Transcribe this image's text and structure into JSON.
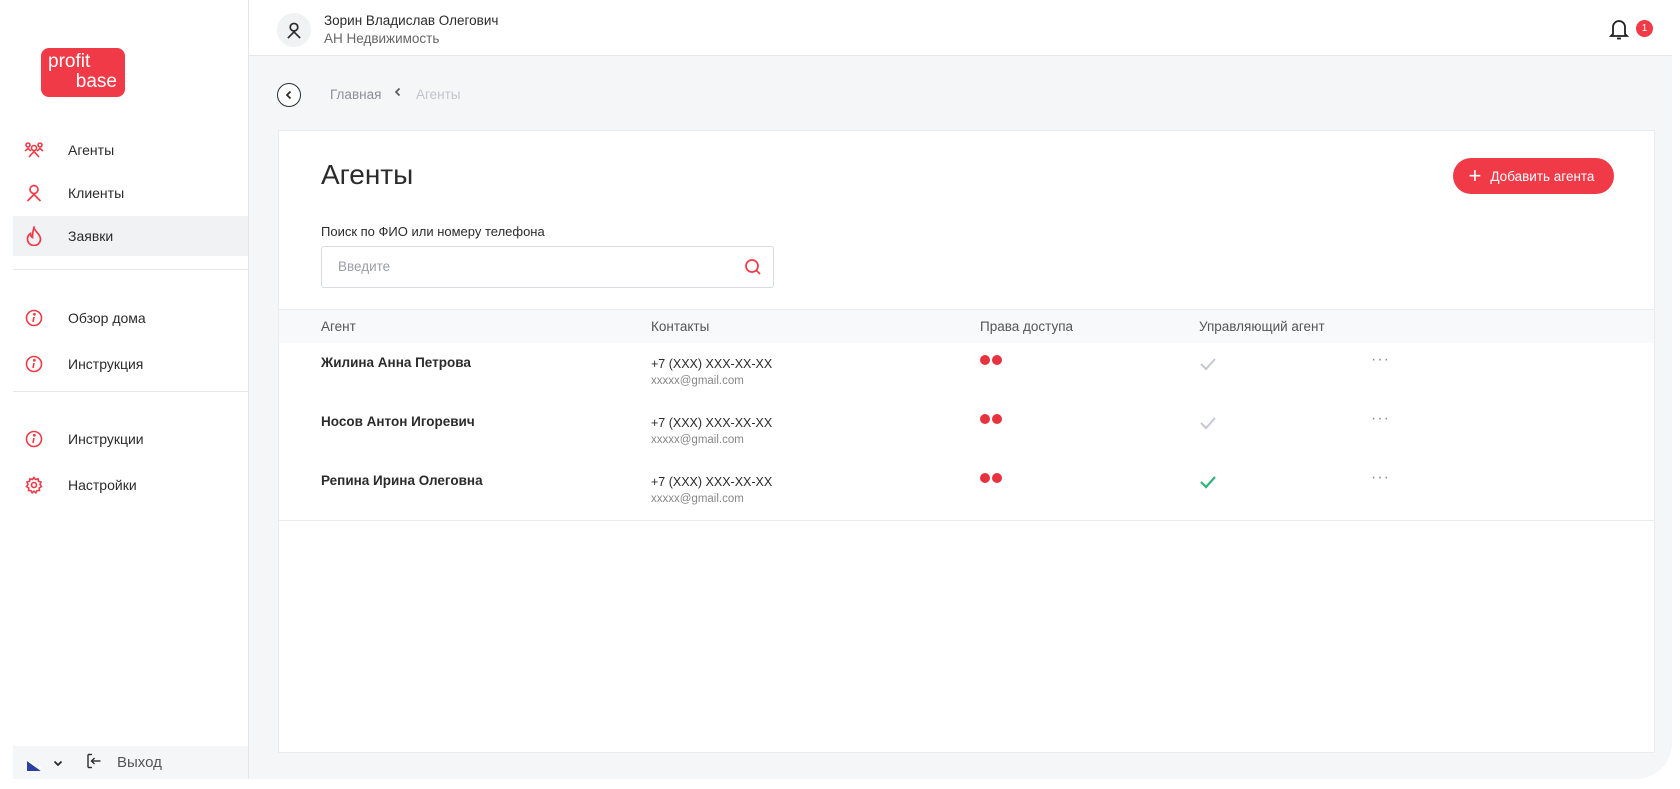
{
  "logo": {
    "line1": "profit",
    "line2": "base",
    "color": "#f03a47"
  },
  "sidebar": {
    "items": [
      {
        "label": "Агенты",
        "icon": "agents-icon"
      },
      {
        "label": "Клиенты",
        "icon": "user-icon"
      },
      {
        "label": "Заявки",
        "icon": "flame-icon",
        "active": true
      },
      {
        "label": "Обзор дома",
        "icon": "info-icon"
      },
      {
        "label": "Инструкция",
        "icon": "info-icon"
      },
      {
        "label": "Инструкции",
        "icon": "info-icon"
      },
      {
        "label": "Настройки",
        "icon": "gear-icon"
      }
    ],
    "logout_label": "Выход"
  },
  "header": {
    "user_name": "Зорин Владислав Олегович",
    "org": "АН Недвижимость",
    "notifications_count": "1"
  },
  "breadcrumb": {
    "home": "Главная",
    "current": "Агенты"
  },
  "main": {
    "title": "Агенты",
    "add_button": "Добавить агента",
    "search": {
      "label": "Поиск по ФИО или номеру телефона",
      "placeholder": "Введите",
      "value": ""
    },
    "columns": [
      "Агент",
      "Контакты",
      "Права доступа",
      "Управляющий агент"
    ],
    "rows": [
      {
        "agent": "Жилина Анна Петрова",
        "phone": "+7 (XXX) XXX-XX-XX",
        "email": "xxxxx@gmail.com",
        "access_dots": 2,
        "managing": false
      },
      {
        "agent": "Носов Антон Игоревич",
        "phone": "+7 (XXX) XXX-XX-XX",
        "email": "xxxxx@gmail.com",
        "access_dots": 2,
        "managing": false
      },
      {
        "agent": "Репина Ирина Олеговна",
        "phone": "+7 (XXX) XXX-XX-XX",
        "email": "xxxxx@gmail.com",
        "access_dots": 2,
        "managing": true
      }
    ]
  },
  "colors": {
    "accent": "#f03a47",
    "check_active": "#2fb57b",
    "check_inactive": "#c5c9cf"
  }
}
